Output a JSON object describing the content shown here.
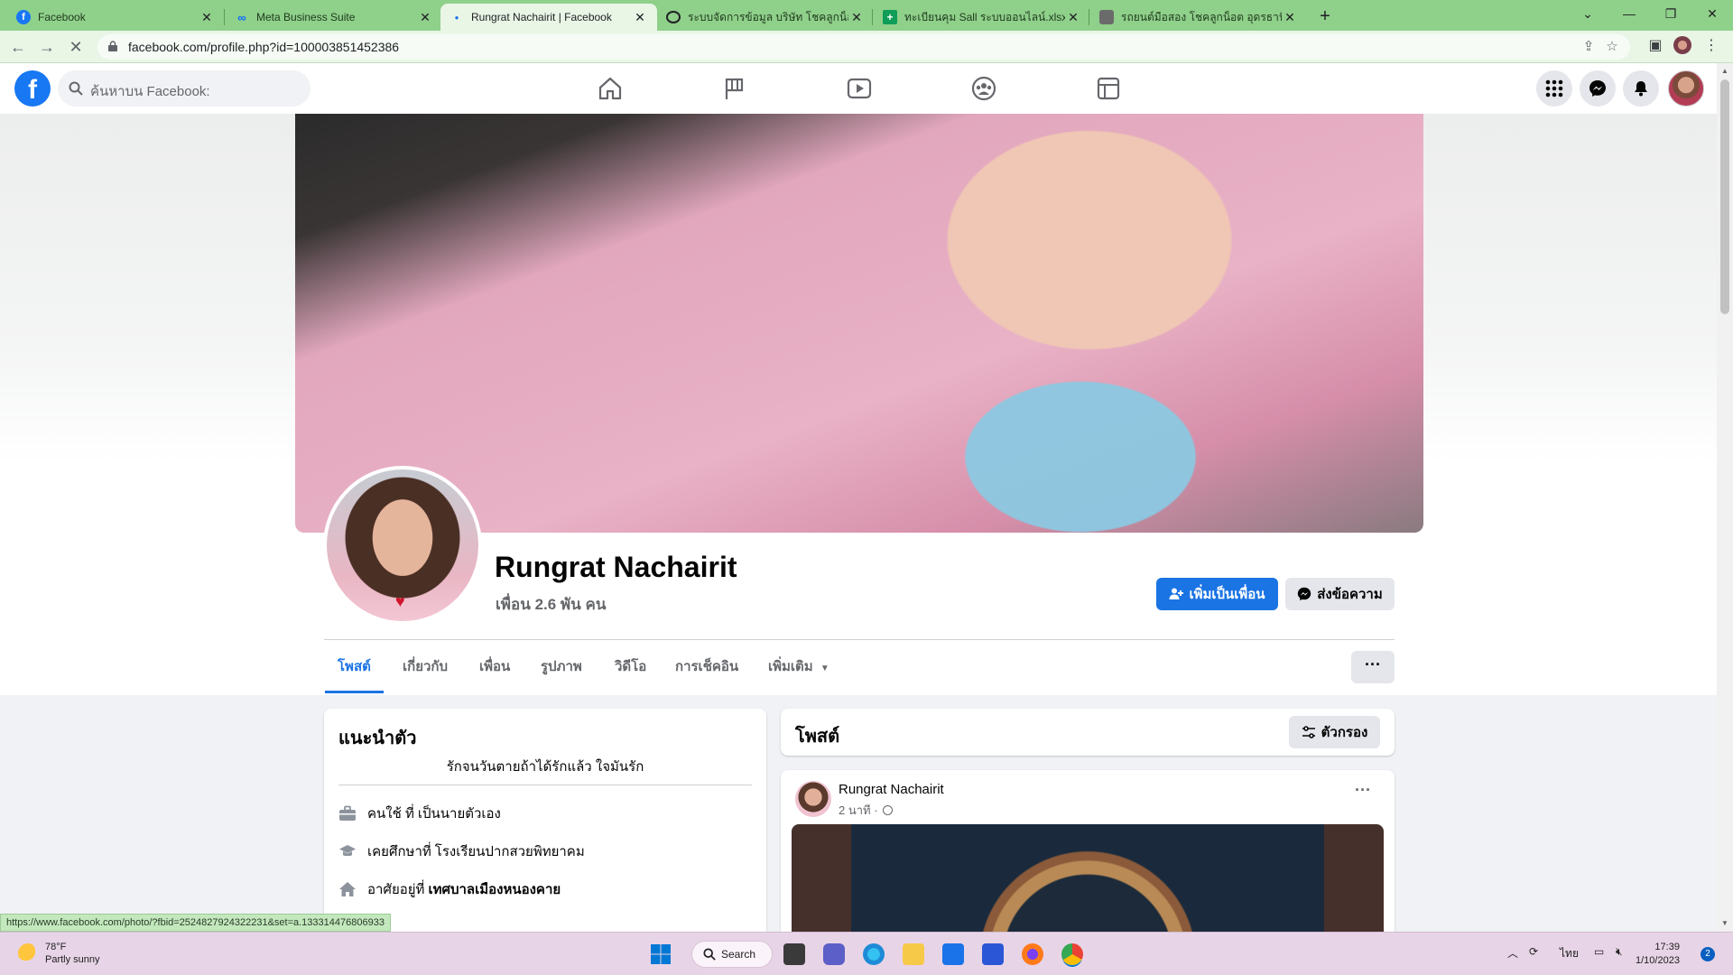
{
  "browser": {
    "tabs": [
      {
        "title": "Facebook",
        "icon": "facebook-icon"
      },
      {
        "title": "Meta Business Suite",
        "icon": "meta-icon"
      },
      {
        "title": "Rungrat Nachairit | Facebook",
        "icon": "loading-dot-icon"
      },
      {
        "title": "ระบบจัดการข้อมูล บริษัท โชคลูกน็อต",
        "icon": "globe-icon"
      },
      {
        "title": "ทะเบียนคุม Sall ระบบออนไลน์.xlsx - G",
        "icon": "sheets-icon"
      },
      {
        "title": "รถยนต์มือสอง โชคลูกน็อต อุดรธานี",
        "icon": "site-icon"
      }
    ],
    "url": "facebook.com/profile.php?id=100003851452386",
    "status_url": "https://www.facebook.com/photo/?fbid=2524827924322231&set=a.133314476806933",
    "colors": {
      "tabstrip": "#8fd08a",
      "toolbar": "#e9f6e6"
    }
  },
  "fb": {
    "search_placeholder": "ค้นหาบน Facebook:",
    "profile": {
      "name": "Rungrat Nachairit",
      "friends": "เพื่อน 2.6 พัน คน",
      "add_friend_label": "เพิ่มเป็นเพื่อน",
      "message_label": "ส่งข้อความ"
    },
    "tabs": [
      {
        "label": "โพสต์",
        "active": true
      },
      {
        "label": "เกี่ยวกับ"
      },
      {
        "label": "เพื่อน"
      },
      {
        "label": "รูปภาพ"
      },
      {
        "label": "วิดีโอ"
      },
      {
        "label": "การเช็คอิน"
      },
      {
        "label": "เพิ่มเติม"
      }
    ],
    "more_label": "···",
    "intro": {
      "title": "แนะนำตัว",
      "bio": "รักจนวันตายถ้าได้รักแล้ว ใจมันรัก",
      "work_prefix": "คนใช้ ที่",
      "work_value": "เป็นนายตัวเอง",
      "edu_prefix": "เคยศึกษาที่",
      "edu_value": "โรงเรียนปากสวยพิทยาคม",
      "home_prefix": "อาศัยอยู่ที่",
      "home_value": "เทศบาลเมืองหนองคาย"
    },
    "posts": {
      "title": "โพสต์",
      "filter_label": "ตัวกรอง",
      "first": {
        "author": "Rungrat Nachairit",
        "time": "2 นาที ·"
      }
    },
    "colors": {
      "brand": "#1877f2",
      "button_primary": "#1b74e4"
    }
  },
  "taskbar": {
    "temp": "78°F",
    "weather": "Partly sunny",
    "search_label": "Search",
    "lang": "ไทย",
    "time": "17:39",
    "date": "1/10/2023",
    "notifications": "2"
  }
}
